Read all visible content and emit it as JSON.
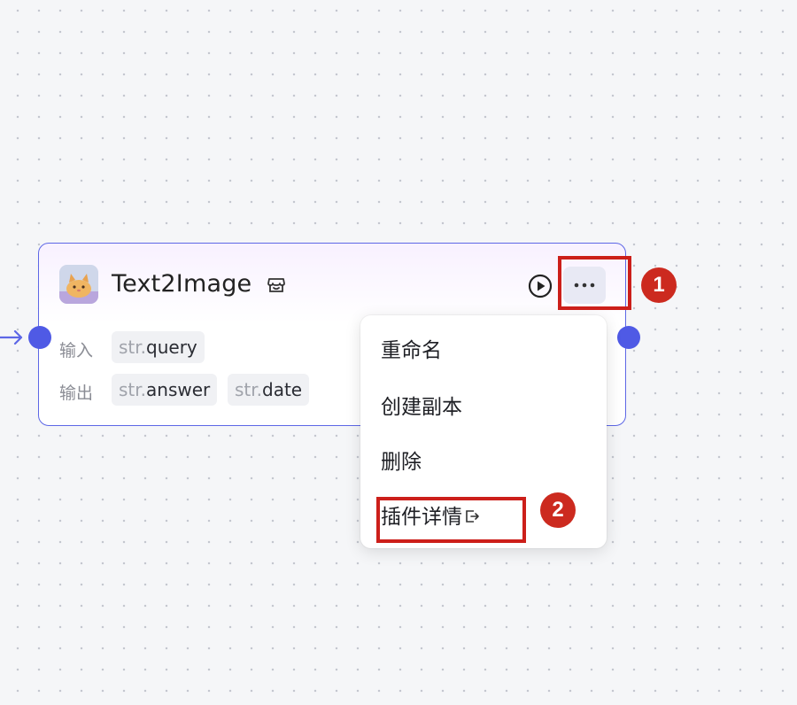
{
  "node": {
    "title": "Text2Image",
    "input_label": "输入",
    "output_label": "输出",
    "inputs": [
      {
        "type": "str.",
        "name": "query"
      }
    ],
    "outputs": [
      {
        "type": "str.",
        "name": "answer"
      },
      {
        "type": "str.",
        "name": "date"
      }
    ],
    "icons": {
      "thumbnail": "plugin-thumbnail-cat",
      "store": "plugin-store-icon",
      "run": "play-circle-icon",
      "more": "more-horizontal-icon"
    }
  },
  "context_menu": {
    "items": [
      {
        "label": "重命名"
      },
      {
        "label": "创建副本"
      },
      {
        "label": "删除"
      },
      {
        "label": "插件详情",
        "icon": "external-link-icon"
      }
    ]
  },
  "annotations": [
    {
      "label": "1"
    },
    {
      "label": "2"
    }
  ],
  "colors": {
    "accent": "#4f5ae5",
    "node_border": "#5d67e6",
    "annotation": "#cc1f1a"
  }
}
